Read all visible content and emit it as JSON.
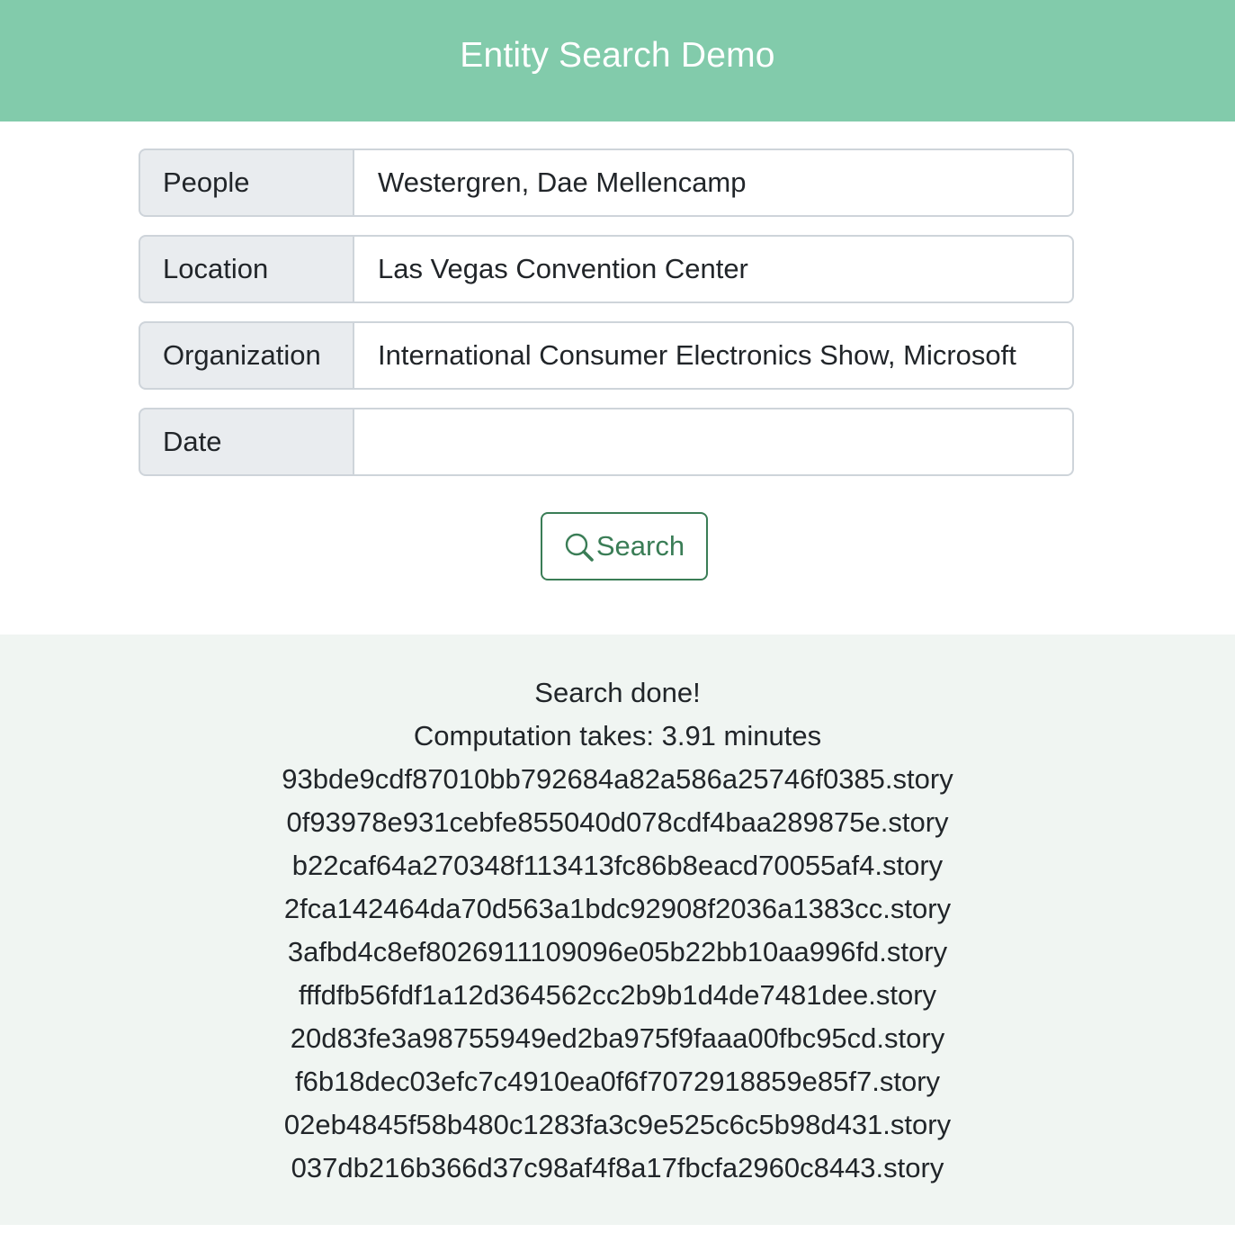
{
  "header": {
    "title": "Entity Search Demo"
  },
  "form": {
    "rows": [
      {
        "label": "People",
        "value": "Westergren, Dae Mellencamp"
      },
      {
        "label": "Location",
        "value": "Las Vegas Convention Center"
      },
      {
        "label": "Organization",
        "value": "International Consumer Electronics Show, Microsoft"
      },
      {
        "label": "Date",
        "value": ""
      }
    ],
    "search_button": {
      "label": "Search",
      "icon": "search-icon"
    }
  },
  "results": {
    "status": "Search done!",
    "computation": "Computation takes: 3.91 minutes",
    "files": [
      "93bde9cdf87010bb792684a82a586a25746f0385.story",
      "0f93978e931cebfe855040d078cdf4baa289875e.story",
      "b22caf64a270348f113413fc86b8eacd70055af4.story",
      "2fca142464da70d563a1bdc92908f2036a1383cc.story",
      "3afbd4c8ef8026911109096e05b22bb10aa996fd.story",
      "fffdfb56fdf1a12d364562cc2b9b1d4de7481dee.story",
      "20d83fe3a98755949ed2ba975f9faaa00fbc95cd.story",
      "f6b18dec03efc7c4910ea0f6f7072918859e85f7.story",
      "02eb4845f58b480c1283fa3c9e525c6c5b98d431.story",
      "037db216b366d37c98af4f8a17fbcfa2960c8443.story"
    ]
  },
  "colors": {
    "header_bg": "#82cbab",
    "accent": "#3a7d56",
    "results_bg": "#f0f5f2"
  }
}
